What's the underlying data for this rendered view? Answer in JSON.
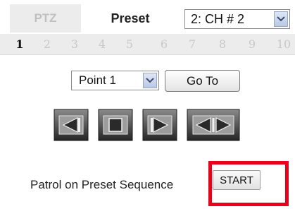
{
  "tabs": [
    {
      "label": "PTZ",
      "active": false
    },
    {
      "label": "Preset",
      "active": true
    }
  ],
  "channel_select": {
    "value": "2: CH # 2"
  },
  "preset_numbers": [
    "1",
    "2",
    "3",
    "4",
    "5",
    "6",
    "7",
    "8",
    "9",
    "10"
  ],
  "active_preset": "1",
  "point_select": {
    "value": "Point 1"
  },
  "goto_label": "Go To",
  "controls": [
    {
      "icon": "rewind-left-icon"
    },
    {
      "icon": "stop-icon"
    },
    {
      "icon": "play-right-icon"
    },
    {
      "icon": "left-right-icon"
    }
  ],
  "patrol": {
    "label": "Patrol on Preset Sequence",
    "button": "START"
  },
  "colors": {
    "highlight": "#e8001c",
    "tab_inactive": "#ececec",
    "control_gradient_top": "#6b6b6b",
    "control_gradient_bottom": "#2a2a2a"
  }
}
